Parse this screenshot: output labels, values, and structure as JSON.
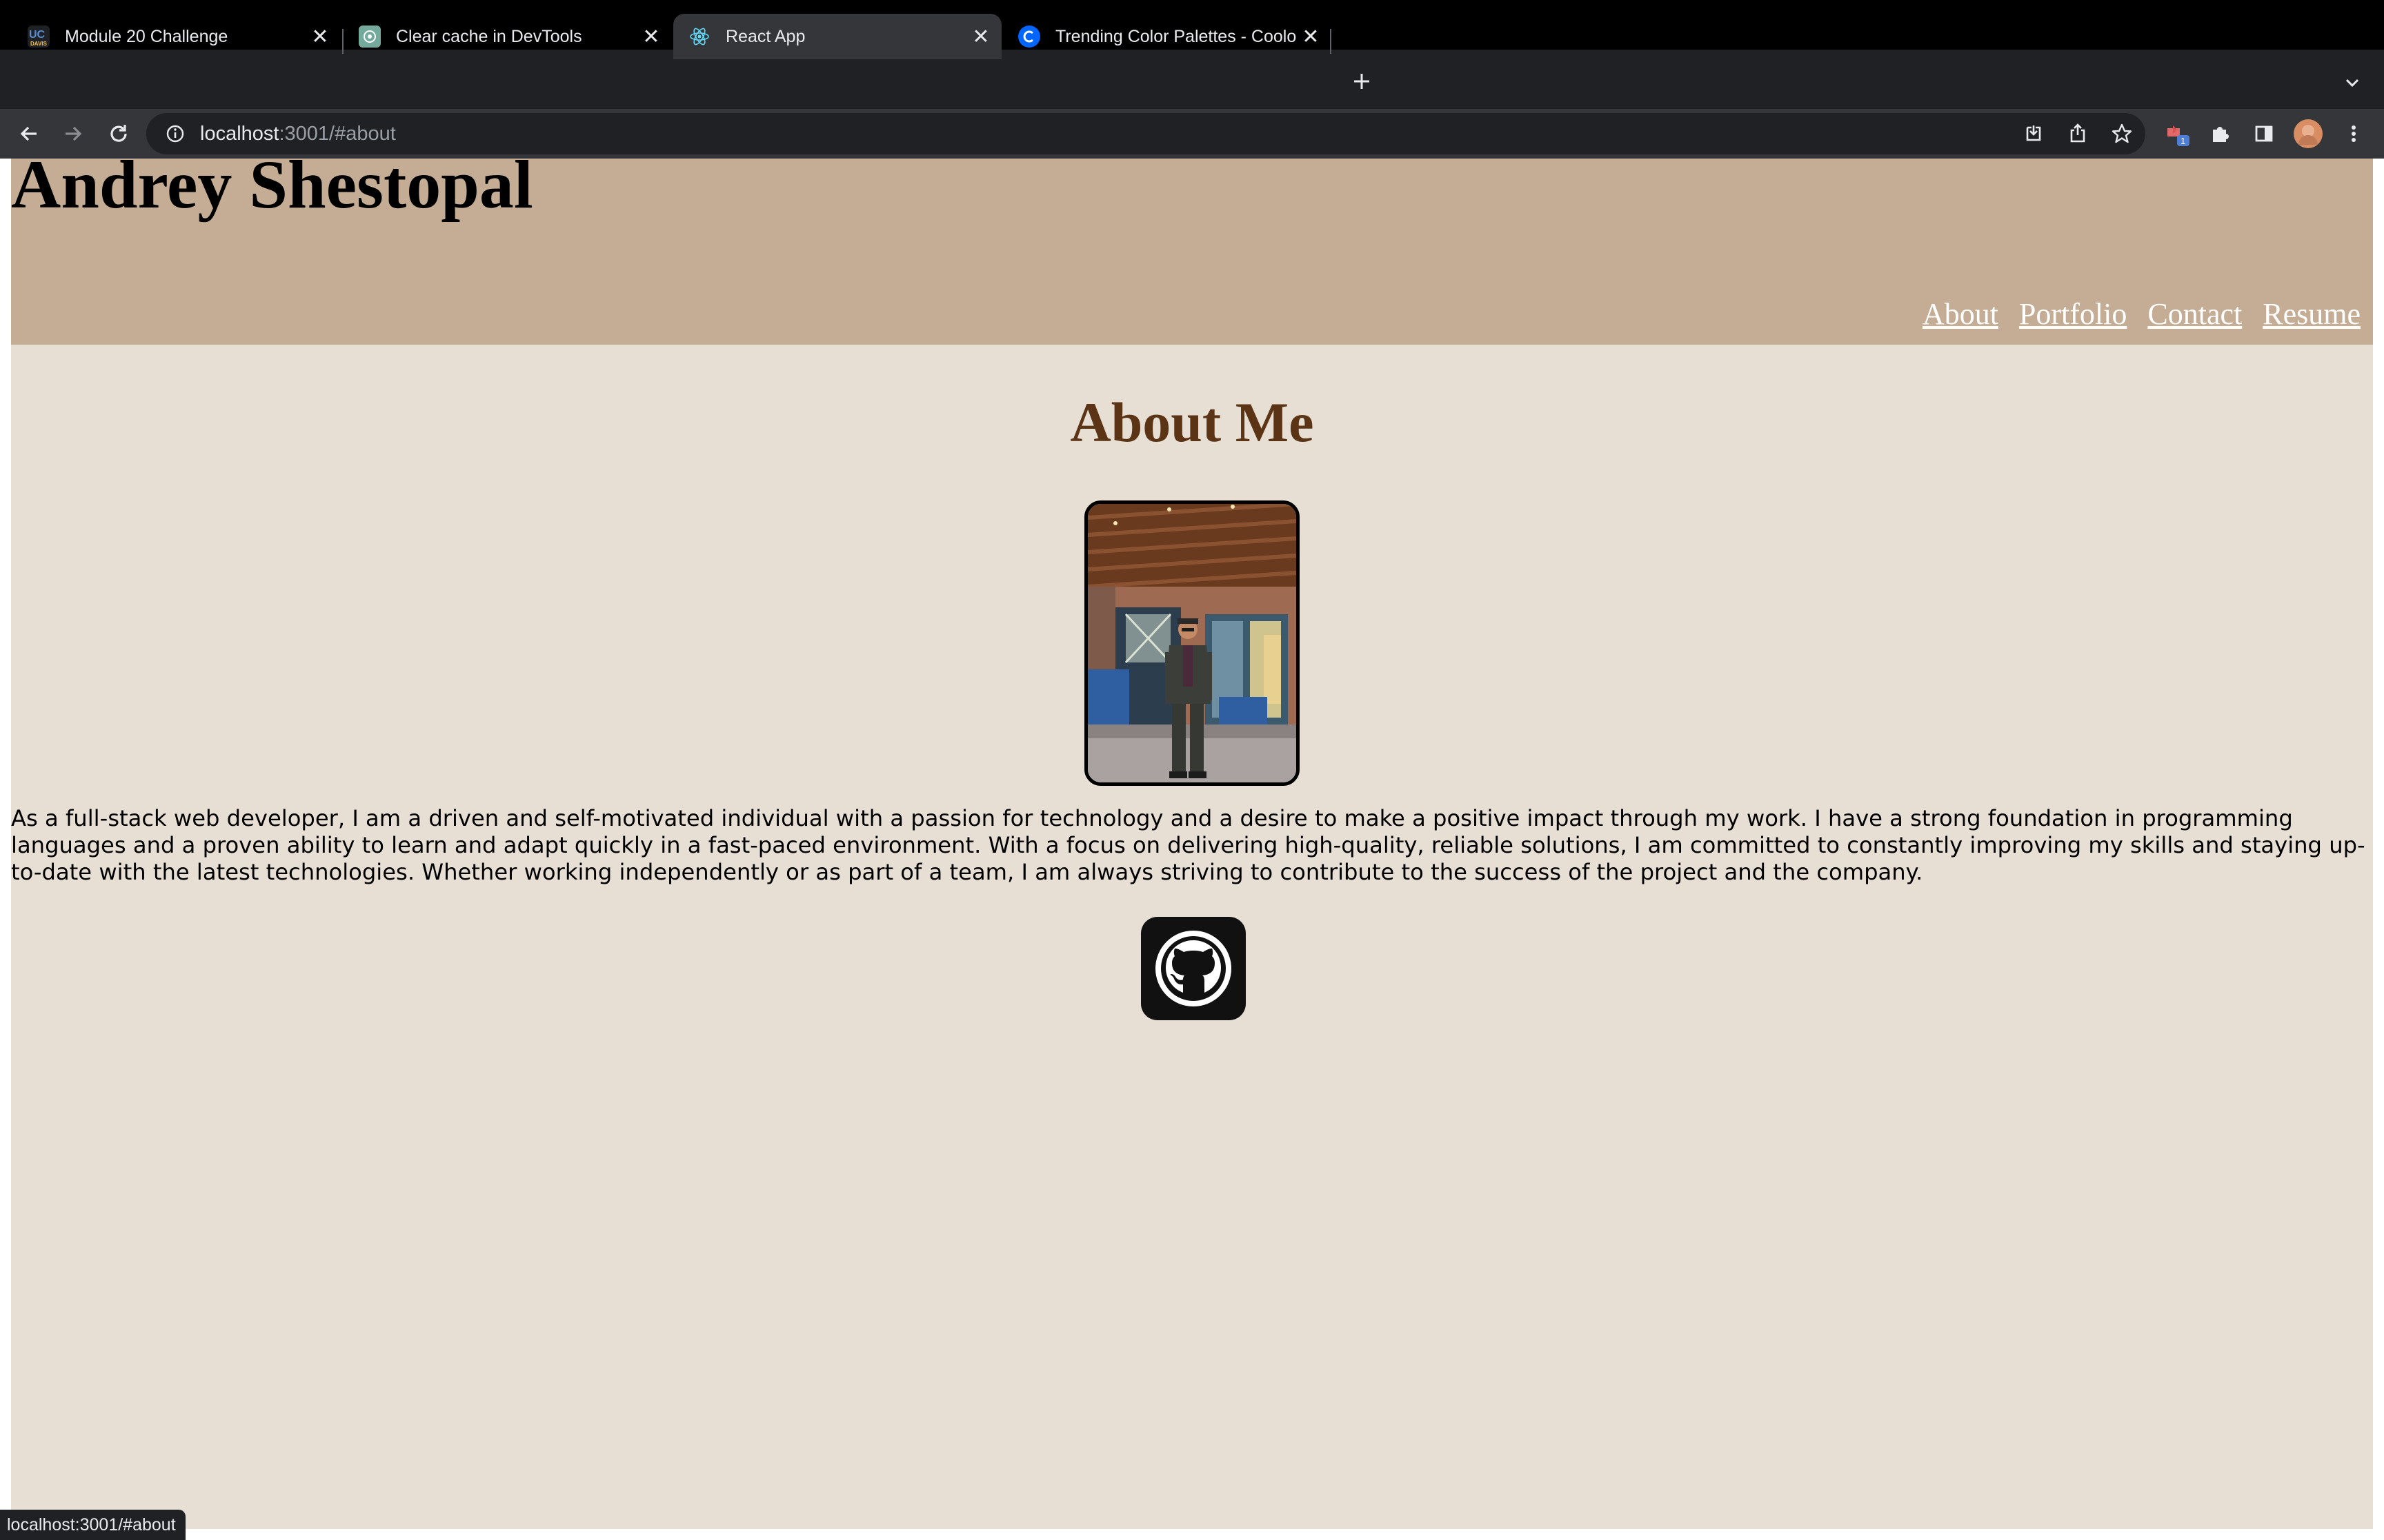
{
  "browser": {
    "tabs": [
      {
        "title": "Module 20 Challenge",
        "favicon": "uc-logo-icon",
        "active": false
      },
      {
        "title": "Clear cache in DevTools",
        "favicon": "chatgpt-icon",
        "active": false
      },
      {
        "title": "React App",
        "favicon": "react-icon",
        "active": true
      },
      {
        "title": "Trending Color Palettes - Coolors",
        "favicon": "coolors-icon",
        "active": false
      }
    ],
    "address_host": "localhost",
    "address_path": ":3001/#about",
    "status_text": "localhost:3001/#about"
  },
  "site": {
    "name": "Andrey Shestopal",
    "nav": [
      "About",
      "Portfolio",
      "Contact",
      "Resume"
    ],
    "about_heading": "About Me",
    "bio": "As a full-stack web developer, I am a driven and self-motivated individual with a passion for technology and a desire to make a positive impact through my work. I have a strong foundation in programming languages and a proven ability to learn and adapt quickly in a fast-paced environment. With a focus on delivering high-quality, reliable solutions, I am committed to constantly improving my skills and staying up-to-date with the latest technologies. Whether working independently or as part of a team, I am always striving to contribute to the success of the project and the company."
  },
  "colors": {
    "header_bg": "#c4ad94",
    "page_bg": "#e7ded4",
    "heading_color": "#5a3414",
    "nav_link": "#ffffff"
  }
}
